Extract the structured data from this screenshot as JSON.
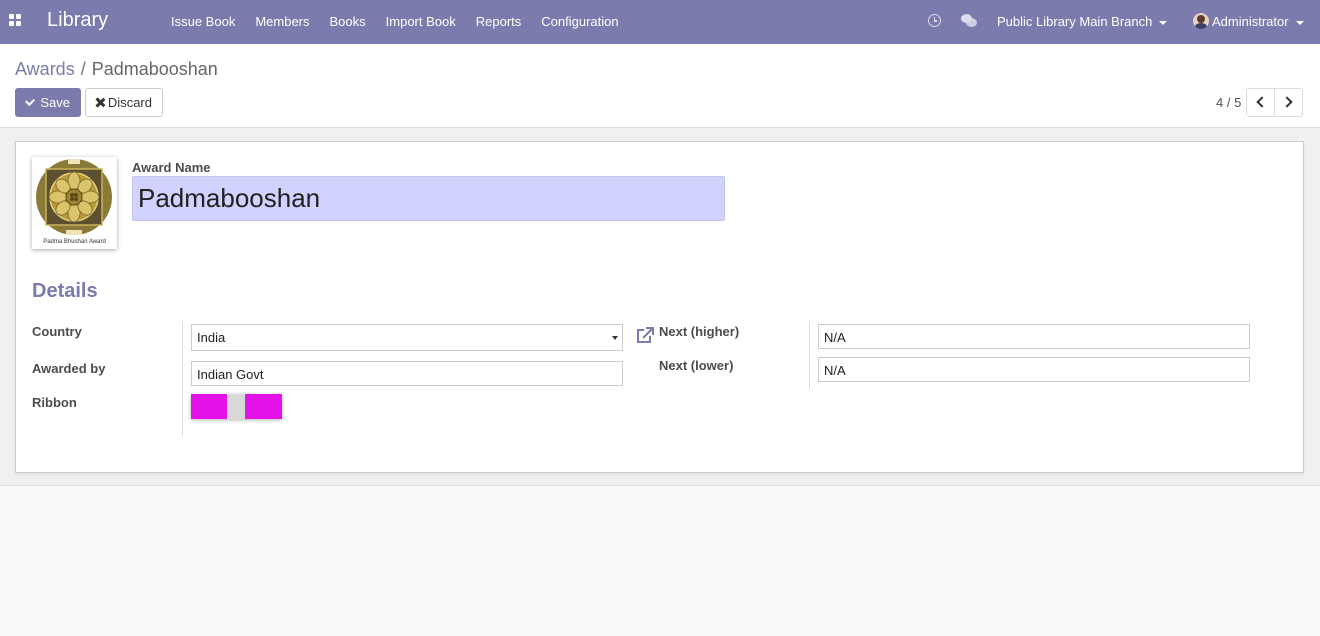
{
  "navbar": {
    "brand": "Library",
    "menu": [
      "Issue Book",
      "Members",
      "Books",
      "Import Book",
      "Reports",
      "Configuration"
    ],
    "branch": "Public Library Main Branch",
    "user": "Administrator",
    "icons": [
      "apps-icon",
      "clock-icon",
      "chat-icon",
      "avatar"
    ]
  },
  "breadcrumb": {
    "parent": "Awards",
    "separator": "/",
    "current": "Padmabooshan"
  },
  "toolbar": {
    "save_label": "Save",
    "discard_label": "Discard"
  },
  "pager": {
    "value": "4 / 5"
  },
  "form": {
    "image_caption": "Padma Bhushan Award",
    "award_name_label": "Award Name",
    "award_name": "Padmabooshan",
    "section_title": "Details",
    "country_label": "Country",
    "country": "India",
    "awarded_by_label": "Awarded by",
    "awarded_by": "Indian Govt",
    "ribbon_label": "Ribbon",
    "ribbon_colors": [
      "#e412e6",
      "#d9d9d9",
      "#e412e6"
    ],
    "next_higher_label": "Next (higher)",
    "next_higher": "N/A",
    "next_lower_label": "Next (lower)",
    "next_lower": "N/A"
  },
  "colors": {
    "brand": "#7c7bad",
    "award_input_bg": "#d2d2ff"
  }
}
